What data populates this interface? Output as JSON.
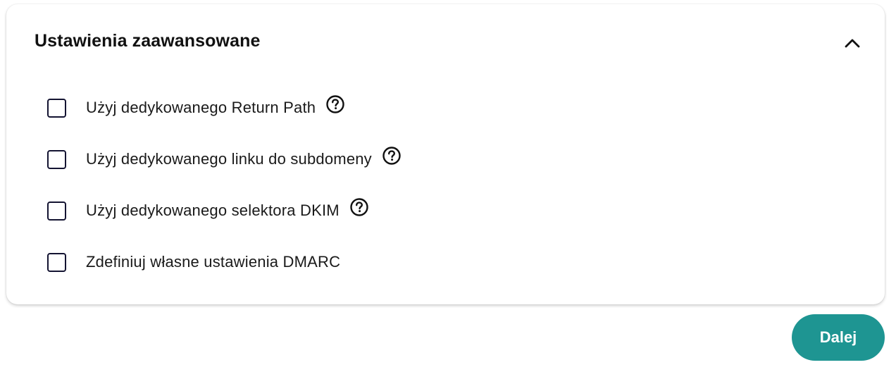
{
  "section": {
    "title": "Ustawienia zaawansowane",
    "toggle_icon": "chevron-up-icon"
  },
  "options": [
    {
      "label": "Użyj dedykowanego Return Path",
      "checked": false,
      "has_help": true
    },
    {
      "label": "Użyj dedykowanego linku do subdomeny",
      "checked": false,
      "has_help": true
    },
    {
      "label": "Użyj dedykowanego selektora DKIM",
      "checked": false,
      "has_help": true
    },
    {
      "label": "Zdefiniuj własne ustawienia DMARC",
      "checked": false,
      "has_help": false
    }
  ],
  "actions": {
    "next_label": "Dalej"
  },
  "colors": {
    "accent": "#1e9592",
    "checkbox_border": "#141432",
    "text": "#1a1a1a"
  }
}
